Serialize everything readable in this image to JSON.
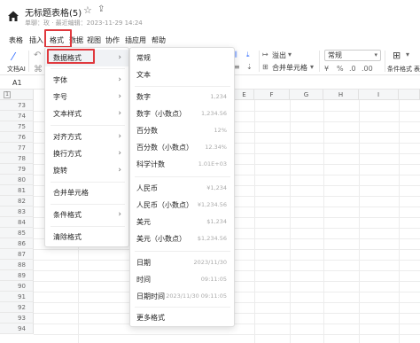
{
  "app": {
    "title": "无标题表格(5)",
    "meta": "单聊：玫 · 最近编辑：2023-11-29 14:24"
  },
  "menubar": [
    "表格",
    "插入",
    "格式",
    "数据",
    "视图",
    "协作",
    "插应用",
    "帮助"
  ],
  "toolbar": {
    "ai_label": "文档AI",
    "overflow_label": "溢出",
    "merge_label": "合并单元格",
    "number_format": "常规",
    "cond_format_label": "条件格式",
    "fill_label": "表"
  },
  "formula": {
    "cellref": "A1"
  },
  "grid": {
    "columns": [
      "E",
      "F",
      "G",
      "H",
      "I"
    ],
    "rows": [
      "73",
      "74",
      "75",
      "76",
      "77",
      "78",
      "79",
      "80",
      "81",
      "82",
      "83",
      "84",
      "85",
      "86",
      "87",
      "88",
      "89",
      "90",
      "91",
      "92",
      "93",
      "94"
    ],
    "top_row": "1"
  },
  "format_menu": [
    {
      "label": "数据格式",
      "arrow": "›"
    },
    {
      "label": "字体",
      "arrow": "›"
    },
    {
      "label": "字号",
      "arrow": "›"
    },
    {
      "label": "文本样式",
      "arrow": "›"
    },
    {
      "label": "对齐方式",
      "arrow": "›"
    },
    {
      "label": "换行方式",
      "arrow": "›"
    },
    {
      "label": "旋转",
      "arrow": "›"
    },
    {
      "label": "合并单元格",
      "arrow": ""
    },
    {
      "label": "条件格式",
      "arrow": "›"
    },
    {
      "label": "清除格式",
      "arrow": ""
    }
  ],
  "data_format_menu": [
    {
      "label": "常规",
      "example": ""
    },
    {
      "label": "文本",
      "example": ""
    },
    {
      "label": "数字",
      "example": "1,234"
    },
    {
      "label": "数字（小数点）",
      "example": "1,234.56"
    },
    {
      "label": "百分数",
      "example": "12%"
    },
    {
      "label": "百分数（小数点）",
      "example": "12.34%"
    },
    {
      "label": "科学计数",
      "example": "1.01E+03"
    },
    {
      "label": "人民币",
      "example": "¥1,234"
    },
    {
      "label": "人民币（小数点）",
      "example": "¥1,234.56"
    },
    {
      "label": "美元",
      "example": "$1,234"
    },
    {
      "label": "美元（小数点）",
      "example": "$1,234.56"
    },
    {
      "label": "日期",
      "example": "2023/11/30"
    },
    {
      "label": "时间",
      "example": "09:11:05"
    },
    {
      "label": "日期时间",
      "example": "2023/11/30 09:11:05"
    },
    {
      "label": "更多格式",
      "example": ""
    }
  ],
  "colors": {
    "highlight": "#e0393e",
    "accent": "#2f6bff"
  }
}
